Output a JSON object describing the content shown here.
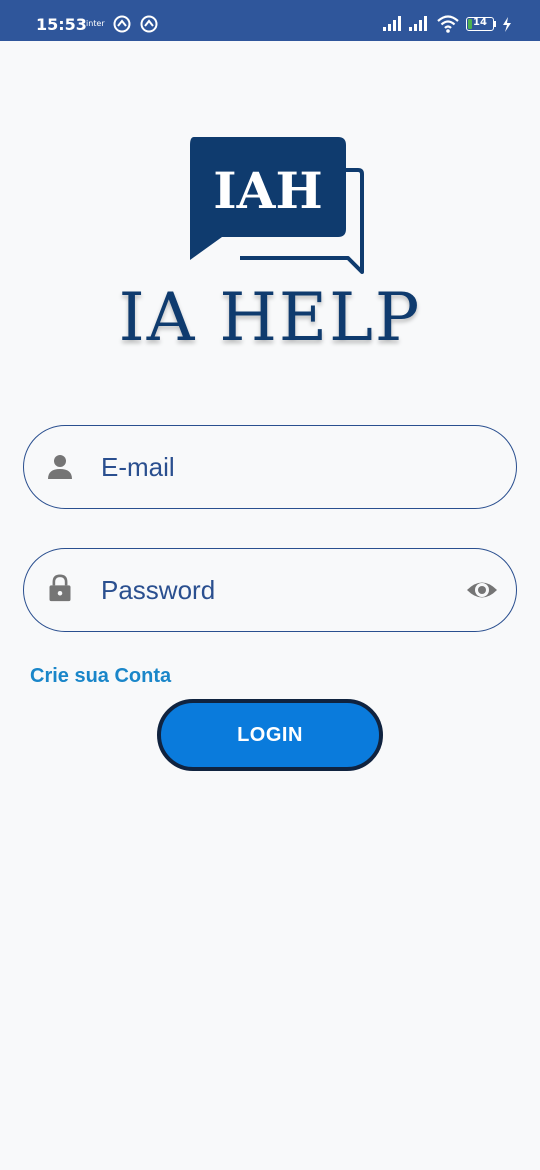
{
  "status_bar": {
    "time": "15:53",
    "carrier": "inter",
    "battery_level": "14",
    "battery_fraction": 0.14,
    "icons": [
      "app-notification-icon",
      "app-notification-icon",
      "signal-icon",
      "signal-icon",
      "wifi-icon",
      "battery-icon",
      "charging-icon"
    ]
  },
  "logo": {
    "badge_text": "IAH",
    "title": "IA HELP",
    "color": "#0f3b6e"
  },
  "login_form": {
    "email_placeholder": "E-mail",
    "password_placeholder": "Password",
    "email_icon": "person-icon",
    "password_icon": "lock-icon",
    "visibility_icon": "eye-icon",
    "create_account_label": "Crie sua Conta",
    "login_label": "LOGIN"
  },
  "colors": {
    "status_bar": "#2f569b",
    "field_border": "#2a4f8f",
    "link": "#1a86c9",
    "button": "#0a7bdc",
    "button_border": "#10233f",
    "background": "#f8f9fa"
  }
}
